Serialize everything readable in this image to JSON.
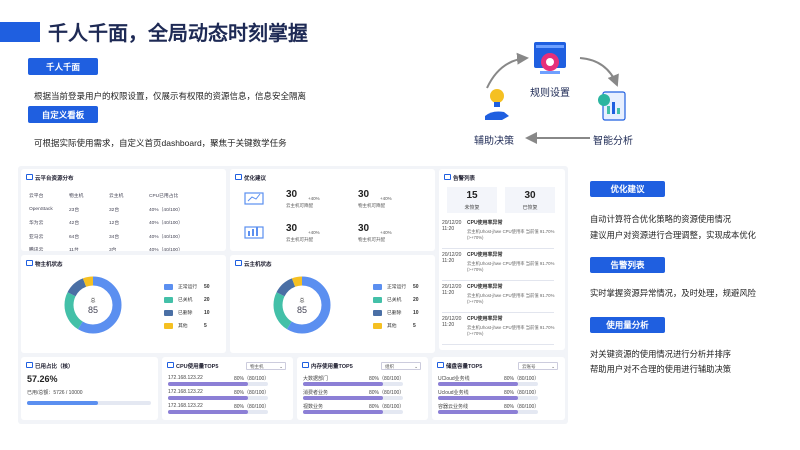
{
  "title": "千人千面，全局动态时刻掌握",
  "left": {
    "tag1": "千人千面",
    "desc1": "根据当前登录用户的权限设置，仅展示有权限的资源信息，信息安全隔离",
    "tag2": "自定义看板",
    "desc2": "可根据实际使用需求，自定义首页dashboard，聚焦于关键数学任务"
  },
  "cycle": {
    "top": "规则设置",
    "right": "智能分析",
    "left": "辅助决策"
  },
  "right_panel": [
    {
      "tag": "优化建议",
      "lines": [
        "自动计算符合优化策略的资源使用情况",
        "建议用户对资源进行合理调整，实现成本优化"
      ]
    },
    {
      "tag": "告警列表",
      "lines": [
        "实时掌握资源异常情况，及时处理，规避风险"
      ]
    },
    {
      "tag": "使用量分析",
      "lines": [
        "对关键资源的使用情况进行分析并排序",
        "帮助用户对不合理的使用进行辅助决策"
      ]
    }
  ],
  "dashboard": {
    "cloud_dist": {
      "title": "云平台资源分布",
      "headers": [
        "云平台",
        "物主机",
        "云主机",
        "CPU已用占比"
      ],
      "rows": [
        [
          "OpenStack",
          "23台",
          "32台",
          "40%（40/100）"
        ],
        [
          "华为云",
          "42台",
          "12台",
          "40%（40/100）"
        ],
        [
          "亚马云",
          "64台",
          "34台",
          "40%（40/100）"
        ],
        [
          "腾讯云",
          "11台",
          "3台",
          "40%（40/100）"
        ]
      ]
    },
    "optimize": {
      "title": "优化建议",
      "items": [
        {
          "num": "30",
          "pct": "+40%",
          "label": "云主机可降配"
        },
        {
          "num": "30",
          "pct": "+40%",
          "label": "物主机可降配"
        },
        {
          "num": "30",
          "pct": "+40%",
          "label": "云主机可升配"
        },
        {
          "num": "30",
          "pct": "+40%",
          "label": "物主机可升配"
        }
      ]
    },
    "alarm": {
      "title": "告警列表",
      "unrecovered_num": "15",
      "unrecovered_label": "未恢复",
      "recovered_num": "30",
      "recovered_label": "已恢复",
      "items": [
        {
          "date": "20/12/20",
          "time": "11:20",
          "title": "CPU使用率异常",
          "text": "云主机Uhost-jhwe CPU使用率 当前值 91.70%(>+70%)"
        },
        {
          "date": "20/12/20",
          "time": "11:20",
          "title": "CPU使用率异常",
          "text": "云主机Uhost-jhwe CPU使用率 当前值 91.70%(>+70%)"
        },
        {
          "date": "20/12/20",
          "time": "11:20",
          "title": "CPU使用率异常",
          "text": "云主机Uhost-jhwe CPU使用率 当前值 91.70%(>+70%)"
        },
        {
          "date": "20/12/20",
          "time": "11:20",
          "title": "CPU使用率异常",
          "text": "云主机Uhost-jhwe CPU使用率 当前值 91.70%(>+70%)"
        }
      ]
    },
    "physical_status": {
      "title": "物主机状态",
      "center_label": "总",
      "center_value": "85",
      "legend": [
        {
          "name": "正常运行",
          "value": "50",
          "fraction": 0.588,
          "color": "#5b8ff0"
        },
        {
          "name": "已关机",
          "value": "20",
          "fraction": 0.235,
          "color": "#43c0a8"
        },
        {
          "name": "已删除",
          "value": "10",
          "fraction": 0.118,
          "color": "#4a6fa5"
        },
        {
          "name": "其他",
          "value": "5",
          "fraction": 0.059,
          "color": "#f5c022"
        }
      ]
    },
    "cloud_status": {
      "title": "云主机状态",
      "center_label": "总",
      "center_value": "85",
      "legend": [
        {
          "name": "正常运行",
          "value": "50",
          "fraction": 0.588,
          "color": "#5b8ff0"
        },
        {
          "name": "已关机",
          "value": "20",
          "fraction": 0.235,
          "color": "#43c0a8"
        },
        {
          "name": "已删除",
          "value": "10",
          "fraction": 0.118,
          "color": "#4a6fa5"
        },
        {
          "name": "其他",
          "value": "5",
          "fraction": 0.059,
          "color": "#f5c022"
        }
      ]
    },
    "usage": {
      "title": "已用占比（核）",
      "percent": "57.26%",
      "detail": "已用/总额：5726 / 10000",
      "fraction": 0.5726
    },
    "cpu_top": {
      "title": "CPU使用量TOP5",
      "select": "物主机",
      "rows": [
        {
          "name": "172.168.123.22",
          "value": "80%（80/100）",
          "fraction": 0.8
        },
        {
          "name": "172.168.123.22",
          "value": "80%（80/100）",
          "fraction": 0.8
        },
        {
          "name": "172.168.123.22",
          "value": "80%（80/100）",
          "fraction": 0.8
        }
      ]
    },
    "mem_top": {
      "title": "内存使用量TOP5",
      "select": "组织",
      "rows": [
        {
          "name": "大数据部门",
          "value": "80%（80/100）",
          "fraction": 0.8
        },
        {
          "name": "消费者业务",
          "value": "80%（80/100）",
          "fraction": 0.8
        },
        {
          "name": "视数业务",
          "value": "80%（80/100）",
          "fraction": 0.8
        }
      ]
    },
    "storage_top": {
      "title": "储盘容量TOP5",
      "select": "云账号",
      "rows": [
        {
          "name": "UCloud业务线",
          "value": "80%（80/100）",
          "fraction": 0.8
        },
        {
          "name": "Ucloud业务线",
          "value": "80%（80/100）",
          "fraction": 0.8
        },
        {
          "name": "容器云业务线",
          "value": "80%（80/100）",
          "fraction": 0.8
        }
      ]
    }
  },
  "colors": {
    "accent": "#1f5fe0",
    "title": "#1e2a55",
    "bar": "#8c7fd6"
  }
}
